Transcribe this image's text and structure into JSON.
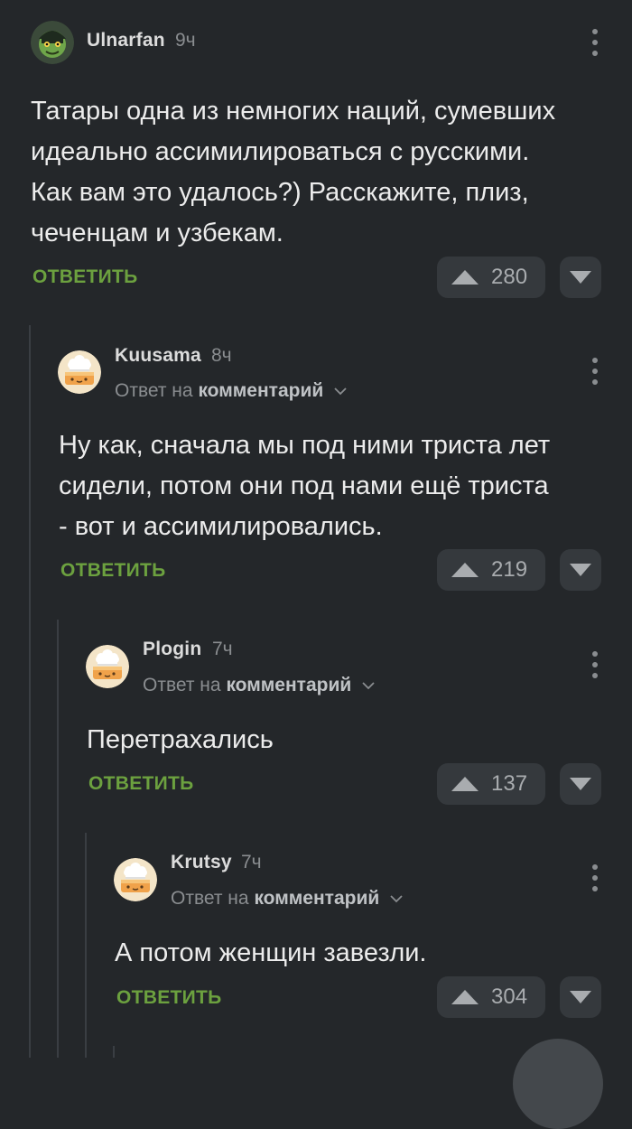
{
  "colors": {
    "background": "#24272a",
    "accent_reply": "#6ca13f",
    "button_bg": "#35393d"
  },
  "comments": [
    {
      "username": "Ulnarfan",
      "time": "9ч",
      "reply_prefix": "",
      "reply_target": "",
      "text_lines": [
        "Татары одна из немногих наций, сумевших",
        "идеально ассимилироваться с русскими.",
        "Как вам это удалось?) Расскажите, плиз,",
        "чеченцам и узбекам."
      ],
      "reply_label": "ОТВЕТИТЬ",
      "rating": "280",
      "avatar": "green-creature-avatar"
    },
    {
      "username": "Kuusama",
      "time": "8ч",
      "reply_prefix": "Ответ на",
      "reply_target": "комментарий",
      "text_lines": [
        "Ну как, сначала мы под ними триста лет",
        "сидели, потом они под нами ещё триста",
        "- вот и ассимилировались."
      ],
      "reply_label": "ОТВЕТИТЬ",
      "rating": "219",
      "avatar": "default-cookie-avatar"
    },
    {
      "username": "Plogin",
      "time": "7ч",
      "reply_prefix": "Ответ на",
      "reply_target": "комментарий",
      "text_lines": [
        "Перетрахались"
      ],
      "reply_label": "ОТВЕТИТЬ",
      "rating": "137",
      "avatar": "default-cookie-avatar"
    },
    {
      "username": "Krutsy",
      "time": "7ч",
      "reply_prefix": "Ответ на",
      "reply_target": "комментарий",
      "text_lines": [
        "А потом женщин завезли."
      ],
      "reply_label": "ОТВЕТИТЬ",
      "rating": "304",
      "avatar": "default-cookie-avatar"
    }
  ]
}
